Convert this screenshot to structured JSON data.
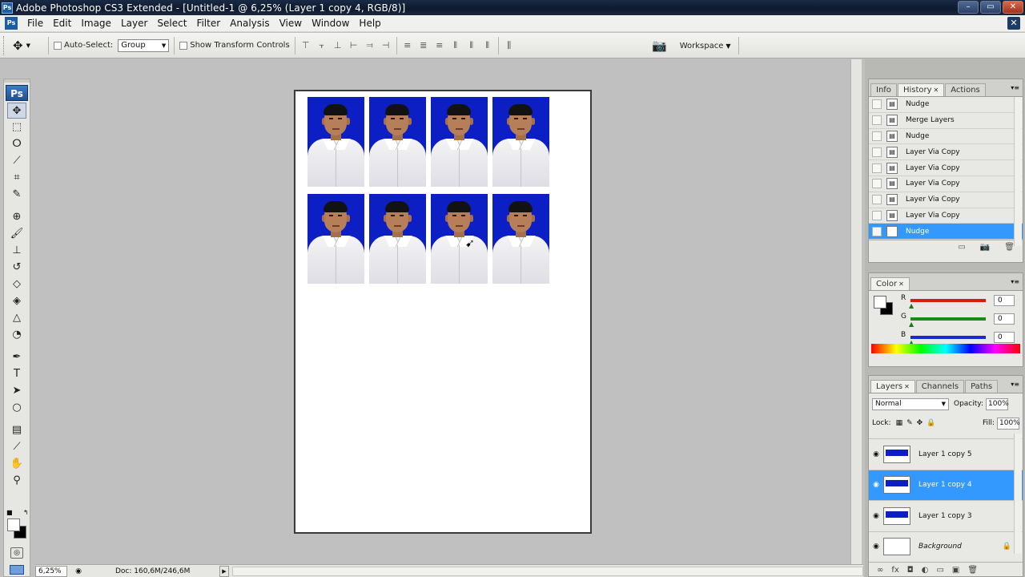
{
  "window": {
    "title": "Adobe Photoshop CS3 Extended - [Untitled-1 @ 6,25% (Layer 1 copy 4, RGB/8)]",
    "app_badge": "Ps",
    "buttons": [
      "–",
      "▭",
      "✕"
    ]
  },
  "menu": {
    "items": [
      "File",
      "Edit",
      "Image",
      "Layer",
      "Select",
      "Filter",
      "Analysis",
      "View",
      "Window",
      "Help"
    ],
    "doc_close": "✕"
  },
  "options": {
    "auto_select_label": "Auto-Select:",
    "auto_select_value": "Group",
    "show_transform_label": "Show Transform Controls",
    "workspace_label": "Workspace"
  },
  "toolbox": {
    "logo": "Ps",
    "tools": [
      "move-tool",
      "marquee-tool",
      "lasso-tool",
      "magic-wand-tool",
      "crop-tool",
      "slice-tool",
      "healing-brush-tool",
      "brush-tool",
      "clone-stamp-tool",
      "history-brush-tool",
      "eraser-tool",
      "paint-bucket-tool",
      "blur-tool",
      "dodge-tool",
      "pen-tool",
      "type-tool",
      "path-selection-tool",
      "shape-tool",
      "notes-tool",
      "eyedropper-tool",
      "hand-tool",
      "zoom-tool"
    ]
  },
  "document": {
    "photo_rows": 2,
    "photo_cols": 4,
    "background_color": "#0b1fc5"
  },
  "status": {
    "zoom": "6,25%",
    "doc_info": "Doc: 160,6M/246,6M"
  },
  "history_panel": {
    "tabs": [
      {
        "label": "Info",
        "active": false
      },
      {
        "label": "History",
        "active": true
      },
      {
        "label": "Actions",
        "active": false
      }
    ],
    "items": [
      {
        "label": "Nudge",
        "selected": false
      },
      {
        "label": "Merge Layers",
        "selected": false
      },
      {
        "label": "Nudge",
        "selected": false
      },
      {
        "label": "Layer Via Copy",
        "selected": false
      },
      {
        "label": "Layer Via Copy",
        "selected": false
      },
      {
        "label": "Layer Via Copy",
        "selected": false
      },
      {
        "label": "Layer Via Copy",
        "selected": false
      },
      {
        "label": "Layer Via Copy",
        "selected": false
      },
      {
        "label": "Nudge",
        "selected": true
      }
    ]
  },
  "color_panel": {
    "tab": "Color",
    "channels": [
      {
        "label": "R",
        "value": "0",
        "color": "#d81e0a"
      },
      {
        "label": "G",
        "value": "0",
        "color": "#1a8a1a"
      },
      {
        "label": "B",
        "value": "0",
        "color": "#1a2ad0"
      }
    ]
  },
  "layers_panel": {
    "tabs": [
      {
        "label": "Layers",
        "active": true
      },
      {
        "label": "Channels",
        "active": false
      },
      {
        "label": "Paths",
        "active": false
      }
    ],
    "blend_mode": "Normal",
    "opacity_label": "Opacity:",
    "opacity": "100%",
    "lock_label": "Lock:",
    "fill_label": "Fill:",
    "fill": "100%",
    "layers": [
      {
        "name": "Layer 1 copy 5",
        "selected": false,
        "is_background": false
      },
      {
        "name": "Layer 1 copy 4",
        "selected": true,
        "is_background": false
      },
      {
        "name": "Layer 1 copy 3",
        "selected": false,
        "is_background": false
      },
      {
        "name": "Background",
        "selected": false,
        "is_background": true
      }
    ]
  }
}
